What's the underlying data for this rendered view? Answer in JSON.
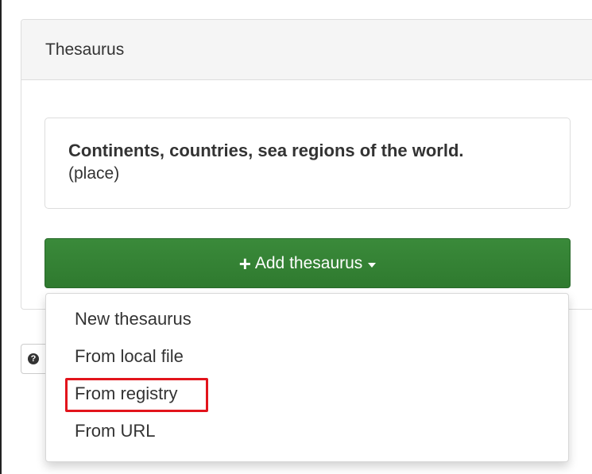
{
  "panel": {
    "heading": "Thesaurus"
  },
  "thesaurus": {
    "title": "Continents, countries, sea regions of the world.",
    "type": "(place)"
  },
  "add_button": {
    "icon": "plus-icon",
    "label": "Add thesaurus",
    "caret": "caret-down-icon",
    "color": "#3a8a3a"
  },
  "help_button": {
    "icon": "question-circle-icon"
  },
  "dropdown": {
    "items": [
      {
        "label": "New thesaurus"
      },
      {
        "label": "From local file"
      },
      {
        "label": "From registry"
      },
      {
        "label": "From URL"
      }
    ]
  },
  "annotation": {
    "highlight_color": "#e2141c"
  }
}
